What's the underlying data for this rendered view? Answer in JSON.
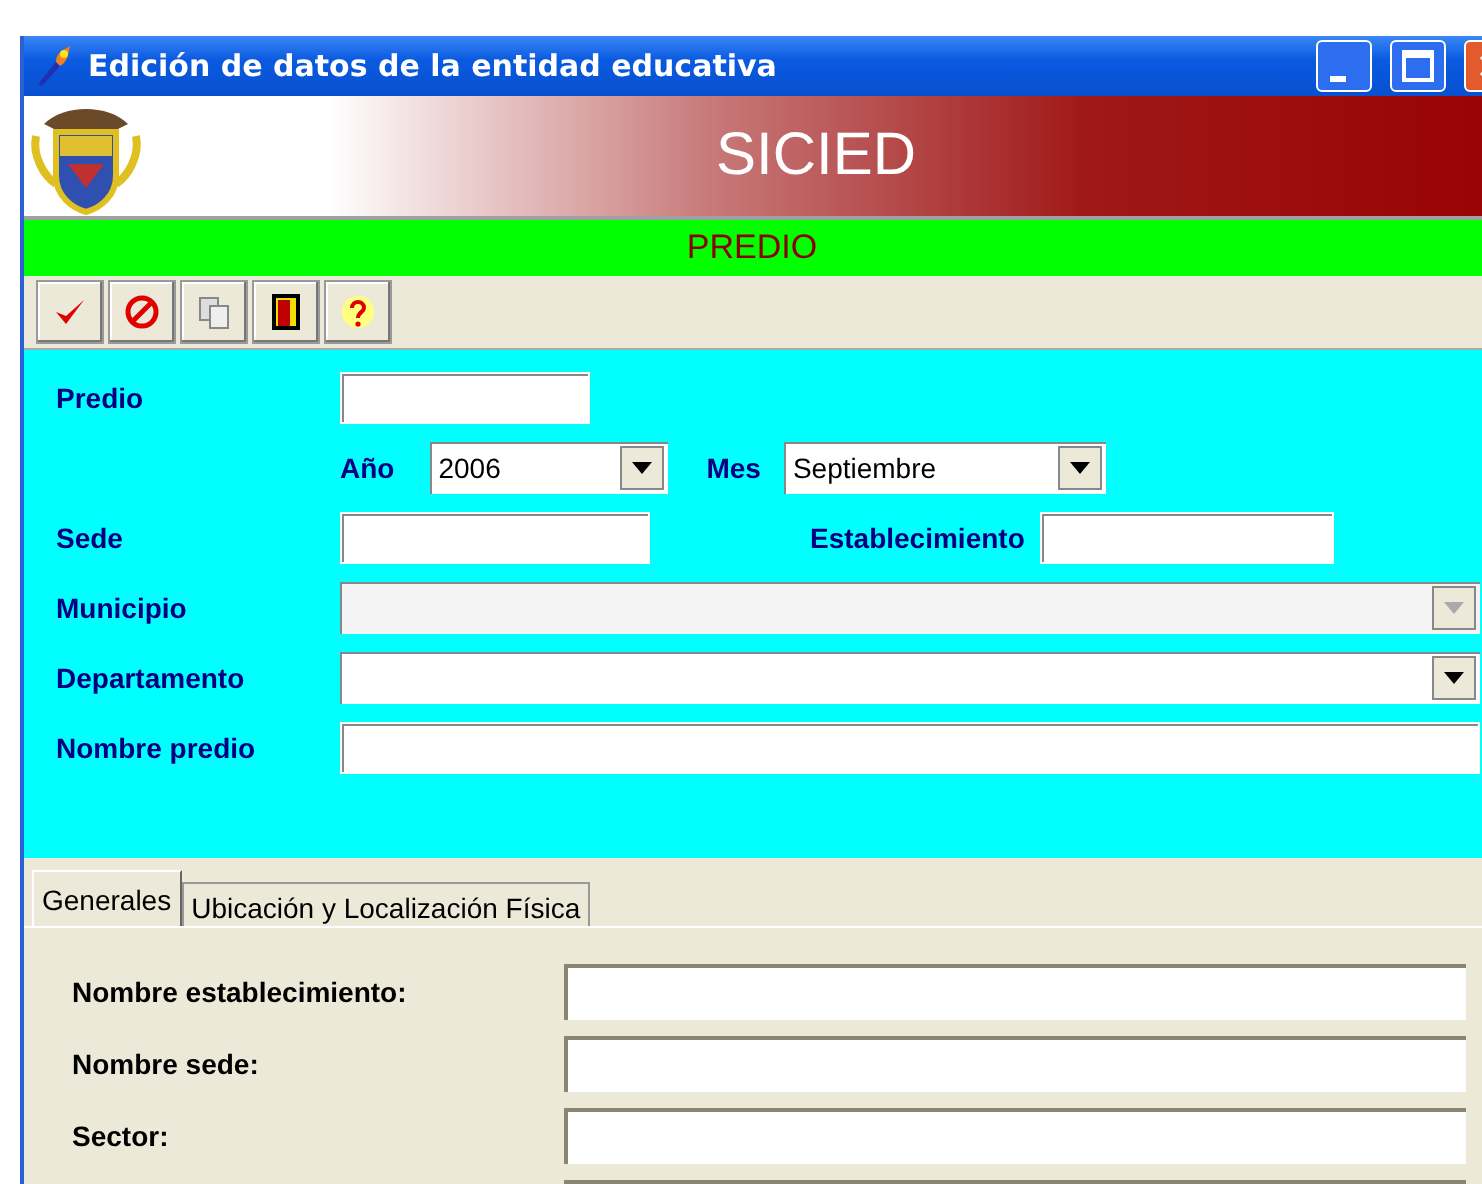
{
  "window": {
    "title": "Edición de datos de la entidad educativa"
  },
  "banner": {
    "title": "SICIED"
  },
  "section": {
    "title": "PREDIO"
  },
  "form": {
    "predio": {
      "label": "Predio"
    },
    "anio": {
      "label": "Año",
      "value": "2006",
      "disabled": false
    },
    "mes": {
      "label": "Mes",
      "value": "Septiembre",
      "disabled": false
    },
    "sede": {
      "label": "Sede"
    },
    "establecimiento": {
      "label": "Establecimiento"
    },
    "municipio": {
      "label": "Municipio",
      "disabled": true
    },
    "departamento": {
      "label": "Departamento",
      "disabled": false
    },
    "nombre_predio": {
      "label": "Nombre predio"
    }
  },
  "tabs": [
    {
      "label": "Generales",
      "selected": true
    },
    {
      "label": "Ubicación y Localización Física",
      "selected": false
    }
  ],
  "general_fields": [
    {
      "label": "Nombre establecimiento:"
    },
    {
      "label": "Nombre sede:"
    },
    {
      "label": "Sector:"
    }
  ]
}
